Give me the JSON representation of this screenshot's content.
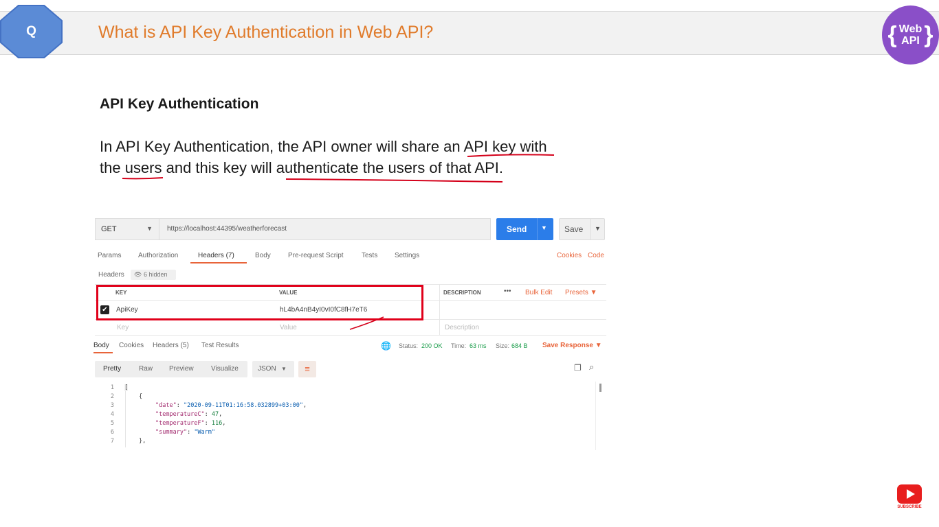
{
  "slide": {
    "icon_letter": "Q",
    "title": "What is API Key Authentication in Web API?",
    "logo_text_line1": "Web",
    "logo_text_line2": "API",
    "logo_brace_open": "{",
    "logo_brace_close": "}",
    "section_heading": "API Key Authentication",
    "paragraph_line1": "In API Key Authentication, the API owner will share an API key with",
    "paragraph_line2": "the users and this key will authenticate the users of that API.",
    "subscribe_label": "SUBSCRIBE"
  },
  "postman": {
    "method": "GET",
    "url": "https://localhost:44395/weatherforecast",
    "send_label": "Send",
    "save_label": "Save",
    "request_tabs": [
      "Params",
      "Authorization",
      "Headers (7)",
      "Body",
      "Pre-request Script",
      "Tests",
      "Settings"
    ],
    "active_request_tab": "Headers (7)",
    "cookies_link": "Cookies",
    "code_link": "Code",
    "headers_label": "Headers",
    "hidden_label": "6 hidden",
    "table": {
      "col_key": "KEY",
      "col_value": "VALUE",
      "col_description": "DESCRIPTION",
      "more": "•••",
      "bulk_edit": "Bulk Edit",
      "presets": "Presets",
      "row": {
        "checked": true,
        "key": "ApiKey",
        "value": "hL4bA4nB4yI0vI0fC8fH7eT6"
      },
      "placeholder_key": "Key",
      "placeholder_value": "Value",
      "placeholder_description": "Description"
    },
    "response_tabs": [
      "Body",
      "Cookies",
      "Headers (5)",
      "Test Results"
    ],
    "active_response_tab": "Body",
    "status_label": "Status:",
    "status_value": "200 OK",
    "time_label": "Time:",
    "time_value": "63 ms",
    "size_label": "Size:",
    "size_value": "684 B",
    "save_response": "Save Response",
    "view_modes": [
      "Pretty",
      "Raw",
      "Preview",
      "Visualize"
    ],
    "format": "JSON",
    "code": {
      "line_numbers": [
        "1",
        "2",
        "3",
        "4",
        "5",
        "6",
        "7"
      ],
      "l1": "[",
      "l2": "{",
      "date_key": "\"date\"",
      "date_val": "\"2020-09-11T01:16:58.032899+03:00\"",
      "tempc_key": "\"temperatureC\"",
      "tempc_val": "47",
      "tempf_key": "\"temperatureF\"",
      "tempf_val": "116",
      "summary_key": "\"summary\"",
      "summary_val": "\"Warm\"",
      "l7": "},"
    }
  },
  "colors": {
    "title_orange": "#e07b2b",
    "octagon_blue": "#5b8bd6",
    "logo_purple": "#8a4fc8",
    "send_blue": "#2b7de9",
    "highlight_red": "#e0001a",
    "postman_orange": "#e8643a"
  }
}
